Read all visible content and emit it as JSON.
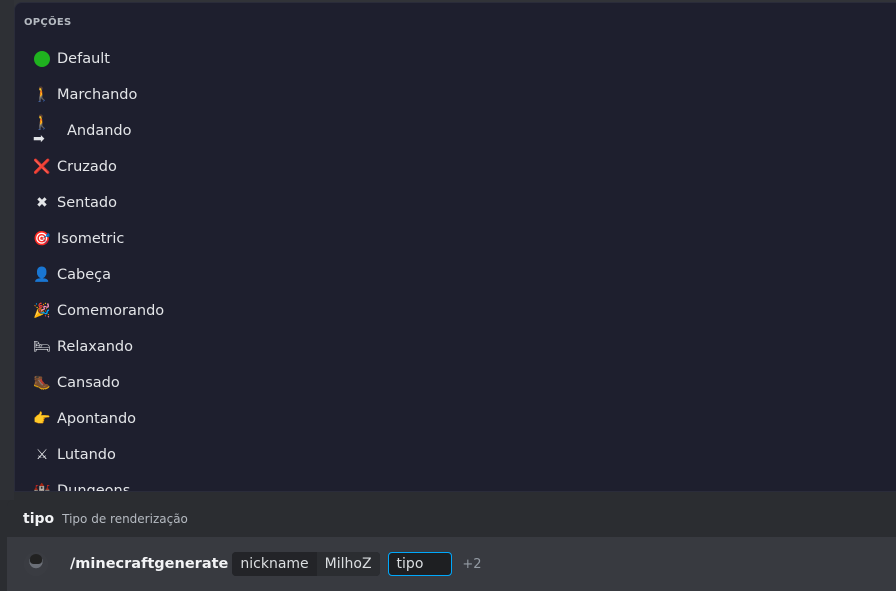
{
  "options": {
    "header": "OPÇÕES",
    "items": [
      {
        "icon": "green-circle-icon",
        "glyph": "",
        "label": "Default"
      },
      {
        "icon": "person-walking-icon",
        "glyph": "🚶",
        "label": "Marchando"
      },
      {
        "icon": "person-walking-arrow-icon",
        "glyph": "🚶➡",
        "label": "Andando"
      },
      {
        "icon": "cross-mark-icon",
        "glyph": "❌",
        "label": "Cruzado"
      },
      {
        "icon": "multiply-x-icon",
        "glyph": "✖",
        "label": "Sentado"
      },
      {
        "icon": "target-icon",
        "glyph": "🎯",
        "label": "Isometric"
      },
      {
        "icon": "bust-head-icon",
        "glyph": "👤",
        "label": "Cabeça"
      },
      {
        "icon": "party-popper-icon",
        "glyph": "🎉",
        "label": "Comemorando"
      },
      {
        "icon": "bed-icon",
        "glyph": "🛏",
        "label": "Relaxando"
      },
      {
        "icon": "boot-icon",
        "glyph": "🥾",
        "label": "Cansado"
      },
      {
        "icon": "pointing-hand-icon",
        "glyph": "👉",
        "label": "Apontando"
      },
      {
        "icon": "crossed-swords-icon",
        "glyph": "⚔",
        "label": "Lutando"
      },
      {
        "icon": "castle-icon",
        "glyph": "🏰",
        "label": "Dungeons"
      }
    ]
  },
  "hint": {
    "name": "tipo",
    "description": "Tipo de renderização"
  },
  "input": {
    "command": "/minecraftgenerate",
    "params": [
      {
        "key": "nickname",
        "value": "MilhoZ"
      }
    ],
    "active_param": "tipo",
    "more": "+2"
  },
  "colors": {
    "panel_bg": "#1e1f2e",
    "input_bg": "#383a40",
    "accent": "#00a8fc",
    "default_dot": "#1fb21f"
  }
}
